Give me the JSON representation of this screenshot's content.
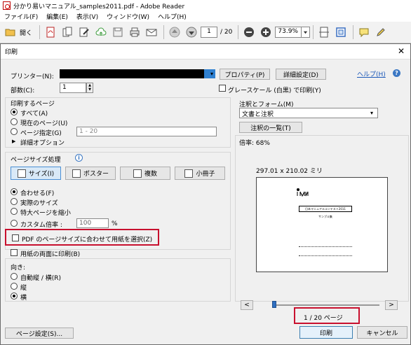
{
  "app": {
    "title": "分かり易いマニュアル_samples2011.pdf - Adobe Reader",
    "menu": [
      "ファイル(F)",
      "編集(E)",
      "表示(V)",
      "ウィンドウ(W)",
      "ヘルプ(H)"
    ],
    "toolbar": {
      "open_label": "開く",
      "page_value": "1",
      "page_count": "/ 20",
      "zoom_value": "73.9%"
    }
  },
  "dialog": {
    "title": "印刷",
    "printer_label": "プリンター(N):",
    "properties_button": "プロパティ(P)",
    "advanced_button": "詳細設定(D)",
    "help_link": "ヘルプ(H)",
    "copies_label": "部数(C):",
    "copies_value": "1",
    "grayscale_label": "グレースケール (白黒) で印刷(Y)",
    "pages_section": {
      "title": "印刷するページ",
      "options": [
        "すべて(A)",
        "現在のページ(U)",
        "ページ指定(G)"
      ],
      "selected": 0,
      "range_placeholder": "1 - 20",
      "more_options": "詳細オプション"
    },
    "sizing_section": {
      "title": "ページサイズ処理",
      "tabs": [
        "サイズ(I)",
        "ポスター",
        "複数",
        "小冊子"
      ],
      "selected_tab": 0,
      "options": [
        "合わせる(F)",
        "実際のサイズ",
        "特大ページを縮小",
        "カスタム倍率 :"
      ],
      "selected": 0,
      "custom_scale_value": "100",
      "custom_scale_unit": "%",
      "choose_paper_label": "PDF のページサイズに合わせて用紙を選択(Z)"
    },
    "duplex_label": "用紙の両面に印刷(B)",
    "orientation": {
      "title": "向き:",
      "options": [
        "自動縦 / 横(R)",
        "縦",
        "横"
      ],
      "selected": 2
    },
    "comments": {
      "title": "注釈とフォーム(M)",
      "value": "文書と注釈",
      "summary_button": "注釈の一覧(T)"
    },
    "preview": {
      "scale_label": "倍率: 68%",
      "size_label": "297.01 x 210.02 ミリ",
      "page_heading": "日本マニュアルコンテスト2011",
      "page_subheading": "サンプル集",
      "prev_label": "<",
      "next_label": ">",
      "page_indicator": "1 / 20 ページ"
    },
    "page_setup_button": "ページ設定(S)...",
    "print_button": "印刷",
    "cancel_button": "キャンセル"
  }
}
